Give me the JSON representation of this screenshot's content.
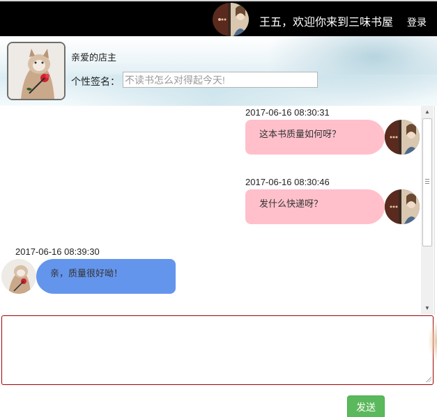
{
  "header": {
    "welcome": "王五，欢迎你来到三味书屋",
    "login": "登录",
    "avatar_icon": "user-avatar-icon"
  },
  "profile": {
    "shop_name": "亲爱的店主",
    "signature_label": "个性签名：",
    "signature_placeholder": "不读书怎么对得起今天!",
    "avatar_icon": "shop-owner-cat-avatar-icon"
  },
  "messages": [
    {
      "side": "right",
      "time": "2017-06-16 08:30:31",
      "text": "这本书质量如何呀？"
    },
    {
      "side": "right",
      "time": "2017-06-16 08:30:46",
      "text": "发什么快递呀？"
    },
    {
      "side": "left",
      "time": "2017-06-16 08:39:30",
      "text": "亲，质量很好呦！"
    }
  ],
  "composer": {
    "text": "",
    "send_label": "发送"
  },
  "colors": {
    "topbar": "#000000",
    "my_bubble": "#ffc0cb",
    "owner_bubble": "#6495ed",
    "send_button": "#5cb85c",
    "input_border": "#a00000"
  }
}
